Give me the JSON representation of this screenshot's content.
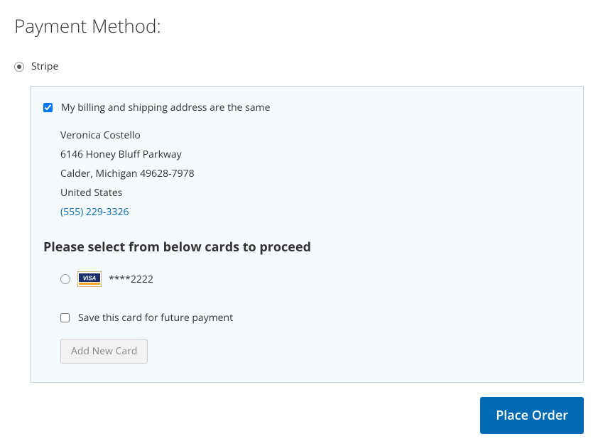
{
  "title": "Payment Method:",
  "method": {
    "label": "Stripe",
    "selected": true
  },
  "billing_same": {
    "label": "My billing and shipping address are the same",
    "checked": true
  },
  "address": {
    "name": "Veronica Costello",
    "street": "6146 Honey Bluff Parkway",
    "city_state_zip": "Calder, Michigan 49628-7978",
    "country": "United States",
    "phone": "(555) 229-3326"
  },
  "card_select_heading": "Please select from below cards to proceed",
  "cards": [
    {
      "brand": "visa",
      "last4": "****2222",
      "selected": false
    }
  ],
  "save_card": {
    "label": "Save this card for future payment",
    "checked": false
  },
  "add_card_label": "Add New Card",
  "place_order_label": "Place Order"
}
